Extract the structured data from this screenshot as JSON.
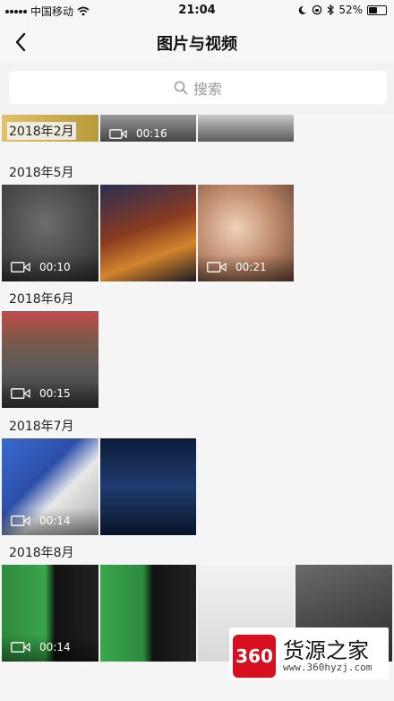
{
  "status_bar": {
    "carrier": "中国移动",
    "time": "21:04",
    "battery": "52%",
    "battery_level": 0.52
  },
  "header": {
    "title": "图片与视频"
  },
  "search": {
    "placeholder": "搜索"
  },
  "sections": [
    {
      "label": "2018年2月",
      "items": [
        {
          "duration": "00:16"
        }
      ]
    },
    {
      "label": "2018年5月",
      "items": [
        {
          "duration": "00:10"
        },
        {
          "duration": ""
        },
        {
          "duration": "00:21"
        }
      ]
    },
    {
      "label": "2018年6月",
      "items": [
        {
          "duration": "00:15"
        }
      ]
    },
    {
      "label": "2018年7月",
      "items": [
        {
          "duration": "00:14"
        },
        {
          "duration": ""
        }
      ]
    },
    {
      "label": "2018年8月",
      "items": [
        {
          "duration": "00:14"
        },
        {
          "duration": ""
        },
        {
          "duration": ""
        },
        {
          "duration": ""
        }
      ]
    }
  ],
  "watermark": {
    "logo": "360",
    "name": "货源之家",
    "url": "www.360hyzj.com"
  },
  "icons": {
    "back": "chevron-left-icon",
    "search": "search-icon",
    "video": "video-camera-icon"
  }
}
